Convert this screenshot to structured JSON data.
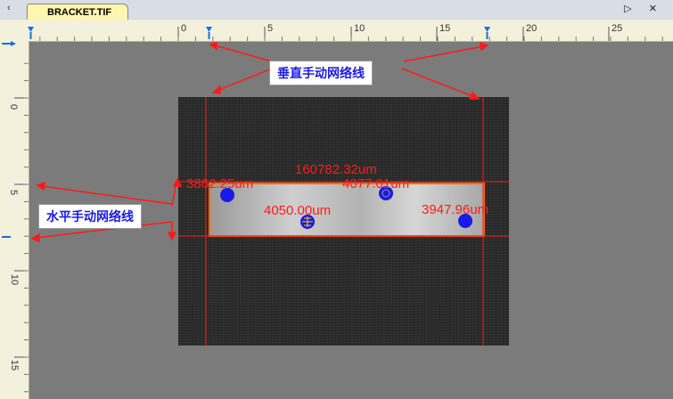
{
  "tab": {
    "title": "BRACKET.TIF",
    "scroll_left": "‹",
    "controls": "▷ ✕"
  },
  "hruler": {
    "labels": [
      "0",
      "5",
      "10",
      "15",
      "20",
      "25"
    ]
  },
  "vruler": {
    "labels": [
      "0",
      "5",
      "10",
      "15"
    ]
  },
  "callouts": {
    "vertical": "垂直手动网络线",
    "horizontal": "水平手动网络线"
  },
  "measurements": [
    "160782.32um",
    "3862.25um",
    "4077.01um",
    "4050.00um",
    "3947.96um"
  ],
  "colors": {
    "grid_line": "#ff1a1a",
    "marker": "#1a1ae6",
    "outline": "#ff6b00"
  }
}
